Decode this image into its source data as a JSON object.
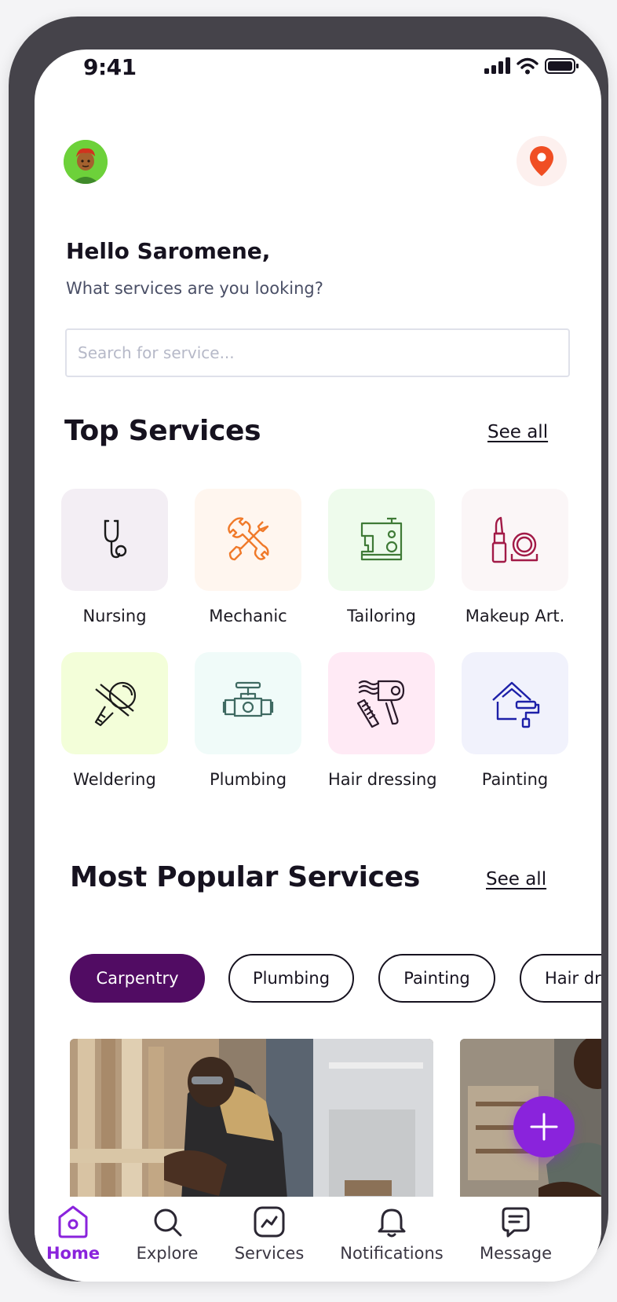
{
  "status_bar": {
    "time": "9:41"
  },
  "header": {
    "greeting": "Hello Saromene,",
    "subtitle": "What services are you looking?"
  },
  "search": {
    "placeholder": "Search for service..."
  },
  "top_services": {
    "title": "Top Services",
    "see_all": "See all",
    "items": [
      {
        "label": "Nursing",
        "icon": "stethoscope-icon",
        "bg": "#f3eef4"
      },
      {
        "label": "Mechanic",
        "icon": "crossed-wrenches-icon",
        "bg": "#fff6ef"
      },
      {
        "label": "Tailoring",
        "icon": "sewing-machine-icon",
        "bg": "#eefbec"
      },
      {
        "label": "Makeup Art.",
        "icon": "lipstick-compact-icon",
        "bg": "#fbf6f7"
      },
      {
        "label": "Weldering",
        "icon": "angle-grinder-icon",
        "bg": "#f3fed9"
      },
      {
        "label": "Plumbing",
        "icon": "pipe-valve-icon",
        "bg": "#f0fbf9"
      },
      {
        "label": "Hair dressing",
        "icon": "hair-dryer-comb-icon",
        "bg": "#ffeaf5"
      },
      {
        "label": "Painting",
        "icon": "house-paint-roller-icon",
        "bg": "#f1f2fc"
      }
    ]
  },
  "popular_services": {
    "title": "Most Popular Services",
    "see_all": "See all",
    "chips": [
      {
        "label": "Carpentry",
        "active": true
      },
      {
        "label": "Plumbing",
        "active": false
      },
      {
        "label": "Painting",
        "active": false
      },
      {
        "label": "Hair dr",
        "active": false
      }
    ]
  },
  "fab": {
    "icon": "plus-icon"
  },
  "bottom_nav": [
    {
      "label": "Home",
      "icon": "home-icon",
      "active": true
    },
    {
      "label": "Explore",
      "icon": "search-icon",
      "active": false
    },
    {
      "label": "Services",
      "icon": "activity-chart-icon",
      "active": false
    },
    {
      "label": "Notifications",
      "icon": "bell-icon",
      "active": false
    },
    {
      "label": "Message",
      "icon": "message-icon",
      "active": false
    }
  ],
  "colors": {
    "accent": "#8a23dc",
    "chip_active": "#510c63",
    "location_pin": "#f04e23",
    "text_primary": "#16121f"
  }
}
